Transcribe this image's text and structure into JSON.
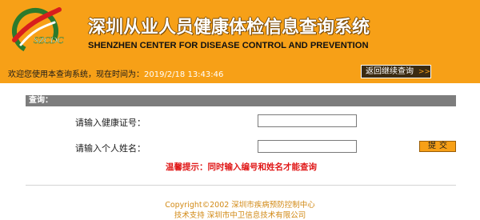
{
  "header": {
    "title_cn": "深圳从业人员健康体检信息查询系统",
    "title_en": "SHENZHEN CENTER FOR DISEASE CONTROL AND PREVENTION",
    "logo_text": "SZCDC",
    "colors": {
      "background": "#f7a017",
      "title_outline": "#7a4a06"
    }
  },
  "welcome": {
    "prefix": "欢迎您使用本查询系统，现在时间为：",
    "time": "2019/2/18 13:43:46"
  },
  "back_button": {
    "label": "返回继续查询",
    "icon": "double-chevron-right-icon"
  },
  "query_panel": {
    "heading": "查询：",
    "fields": [
      {
        "label": "请输入健康证号：",
        "value": "",
        "placeholder": ""
      },
      {
        "label": "请输入个人姓名：",
        "value": "",
        "placeholder": ""
      }
    ],
    "submit_label": "提交",
    "tip": "温馨提示：同时输入编号和姓名才能查询"
  },
  "footer": {
    "line1": "Copyright©2002  深圳市疾病预防控制中心",
    "line2": "技术支持    深圳市中卫信息技术有限公司"
  }
}
